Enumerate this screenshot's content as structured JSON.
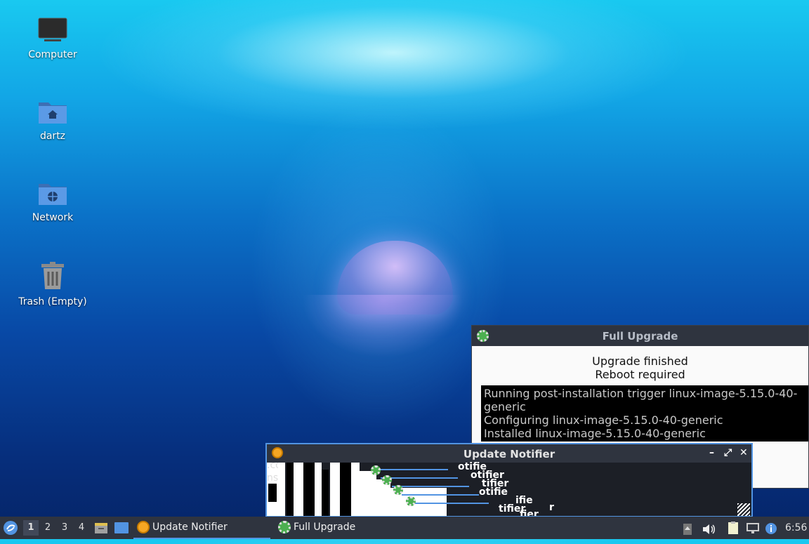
{
  "desktop": {
    "icons": [
      {
        "label": "Computer",
        "icon": "computer-icon"
      },
      {
        "label": "dartz",
        "icon": "home-folder-icon"
      },
      {
        "label": "Network",
        "icon": "network-folder-icon"
      },
      {
        "label": "Trash (Empty)",
        "icon": "trash-icon"
      }
    ]
  },
  "full_upgrade_window": {
    "title": "Full Upgrade",
    "status_line1": "Upgrade finished",
    "status_line2": "Reboot required",
    "log": [
      "Running post-installation trigger linux-image-5.15.0-40-",
      "generic",
      "Configuring linux-image-5.15.0-40-generic",
      "Installed linux-image-5.15.0-40-generic"
    ]
  },
  "update_notifier_window": {
    "title": "Update Notifier",
    "controls": {
      "minimize": "–",
      "maximize": "⤢",
      "close": "✕"
    },
    "glitch_fragments": [
      ".co",
      "ns",
      "otifie",
      "otifier",
      "tifier",
      "otifie",
      "ifie",
      "tifier",
      "fier",
      "r"
    ]
  },
  "taskbar": {
    "workspaces": [
      "1",
      "2",
      "3",
      "4"
    ],
    "active_workspace": "1",
    "tasks": [
      {
        "label": "Update Notifier",
        "active": true
      },
      {
        "label": "Full Upgrade",
        "active": false
      }
    ],
    "clock": "6:56"
  },
  "colors": {
    "accent": "#5294e2",
    "titlebar": "#2f343f"
  }
}
